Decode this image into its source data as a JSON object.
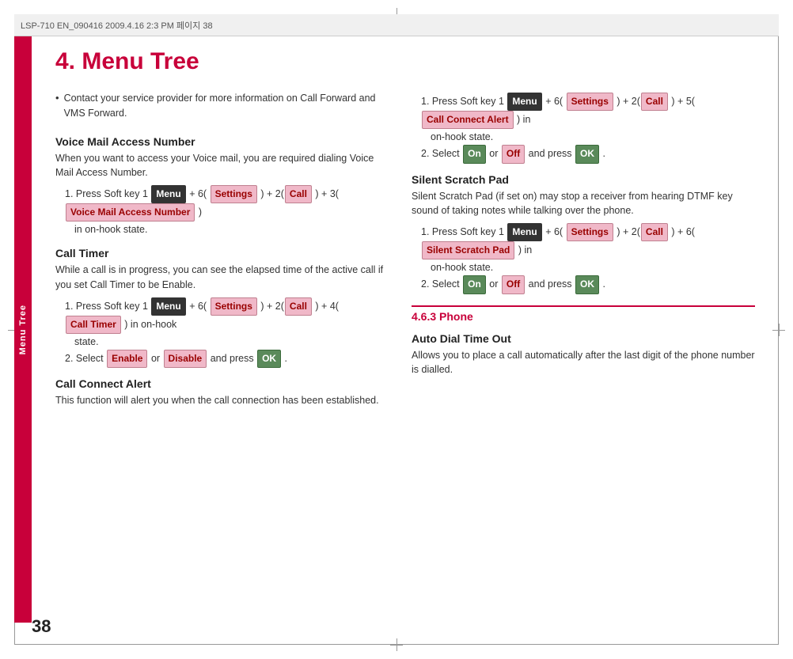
{
  "header": {
    "text": "LSP-710 EN_090416  2009.4.16 2:3 PM  페이지 38"
  },
  "side_label": "Menu Tree",
  "page_number": "38",
  "main_title": "4. Menu Tree",
  "left_col": {
    "bullet_text": "Contact your service provider for more information on Call Forward and VMS Forward.",
    "sections": [
      {
        "heading": "Voice Mail Access Number",
        "body": "When you want to access your Voice mail, you are required dialing Voice Mail Access Number.",
        "steps": [
          {
            "num": "1.",
            "prefix": "Press Soft key 1 ",
            "parts": [
              {
                "text": "Menu",
                "style": "dark"
              },
              {
                "text": " + 6( "
              },
              {
                "text": "Settings",
                "style": "pink"
              },
              {
                "text": " ) + "
              },
              {
                "text": "2(",
                "plain": true
              },
              {
                "text": "Call",
                "style": "pink"
              },
              {
                "text": " ) + 3( "
              },
              {
                "text": "Voice Mail Access Number",
                "style": "pink"
              },
              {
                "text": " )"
              }
            ],
            "suffix": "in on-hook state."
          }
        ]
      },
      {
        "heading": "Call Timer",
        "body": "While a call is in progress, you can see the elapsed time of the active call if you set Call Timer to be Enable.",
        "steps": [
          {
            "num": "1.",
            "prefix": "Press Soft key 1 ",
            "parts": [
              {
                "text": "Menu",
                "style": "dark"
              },
              {
                "text": " + 6( "
              },
              {
                "text": "Settings",
                "style": "pink"
              },
              {
                "text": " ) + "
              },
              {
                "text": "2(",
                "plain": true
              },
              {
                "text": "Call",
                "style": "pink"
              },
              {
                "text": " ) + 4( "
              },
              {
                "text": "Call Timer",
                "style": "pink"
              },
              {
                "text": " ) in on-hook state."
              }
            ],
            "suffix": ""
          },
          {
            "num": "2.",
            "prefix": "Select ",
            "parts": [
              {
                "text": "Enable",
                "style": "pink"
              },
              {
                "text": " or "
              },
              {
                "text": "Disable",
                "style": "pink"
              },
              {
                "text": " and press "
              },
              {
                "text": "OK",
                "style": "green"
              },
              {
                "text": " ."
              }
            ],
            "suffix": ""
          }
        ]
      },
      {
        "heading": "Call Connect Alert",
        "body": "This function will alert you when the call connection has been established.",
        "steps": []
      }
    ]
  },
  "right_col": {
    "call_connect_steps": [
      {
        "num": "1.",
        "prefix": "Press Soft key 1 ",
        "parts": [
          {
            "text": "Menu",
            "style": "dark"
          },
          {
            "text": " + 6( "
          },
          {
            "text": "Settings",
            "style": "pink"
          },
          {
            "text": " ) + "
          },
          {
            "text": "2(",
            "plain": true
          },
          {
            "text": "Call",
            "style": "pink"
          },
          {
            "text": " ) + 5( "
          },
          {
            "text": "Call Connect Alert",
            "style": "pink"
          },
          {
            "text": " ) in on-hook state."
          }
        ],
        "suffix": ""
      },
      {
        "num": "2.",
        "prefix": "Select ",
        "parts": [
          {
            "text": "On",
            "style": "green"
          },
          {
            "text": " or "
          },
          {
            "text": "Off",
            "style": "pink"
          },
          {
            "text": " and press "
          },
          {
            "text": "OK",
            "style": "green"
          },
          {
            "text": " ."
          }
        ],
        "suffix": ""
      }
    ],
    "silent_scratch_pad": {
      "heading": "Silent Scratch Pad",
      "body": "Silent Scratch Pad (if set on) may stop a receiver from hearing DTMF key sound of taking notes while talking over the phone.",
      "steps": [
        {
          "num": "1.",
          "prefix": "Press Soft key 1 ",
          "parts": [
            {
              "text": "Menu",
              "style": "dark"
            },
            {
              "text": " + 6( "
            },
            {
              "text": "Settings",
              "style": "pink"
            },
            {
              "text": " ) + "
            },
            {
              "text": "2(",
              "plain": true
            },
            {
              "text": "Call",
              "style": "pink"
            },
            {
              "text": " ) + 6( "
            },
            {
              "text": "Silent Scratch Pad",
              "style": "pink"
            },
            {
              "text": " ) in on-hook state."
            }
          ],
          "suffix": ""
        },
        {
          "num": "2.",
          "prefix": "Select ",
          "parts": [
            {
              "text": "On",
              "style": "green"
            },
            {
              "text": " or "
            },
            {
              "text": "Off",
              "style": "pink"
            },
            {
              "text": " and press "
            },
            {
              "text": "OK",
              "style": "green"
            },
            {
              "text": " ."
            }
          ],
          "suffix": ""
        }
      ]
    },
    "phone_section": {
      "divider_title": "4.6.3 Phone",
      "heading": "Auto Dial Time Out",
      "body": "Allows you to place a call automatically after the last digit of the phone number is dialled."
    }
  }
}
